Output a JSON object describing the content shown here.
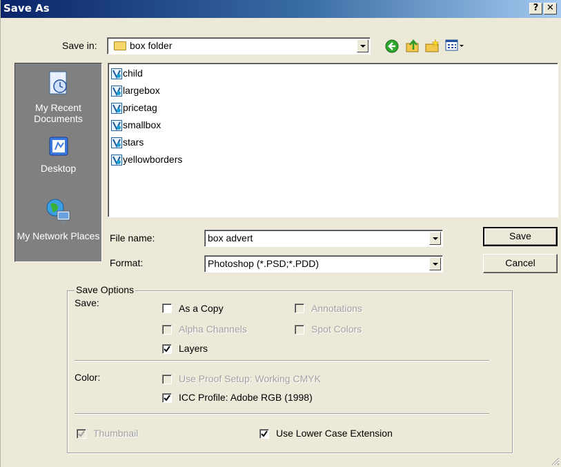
{
  "window": {
    "title": "Save As",
    "help_label": "?",
    "close_label": "✕"
  },
  "save_in": {
    "label": "Save in:",
    "value": "box folder"
  },
  "toolbar_icons": [
    "back-icon",
    "up-folder-icon",
    "new-folder-icon",
    "views-menu-icon"
  ],
  "places": [
    {
      "label": "My Recent Documents"
    },
    {
      "label": "Desktop"
    },
    {
      "label": "My Network Places"
    }
  ],
  "files": [
    "child",
    "largebox",
    "pricetag",
    "smallbox",
    "stars",
    "yellowborders"
  ],
  "file_name": {
    "label": "File name:",
    "value": "box advert"
  },
  "format": {
    "label": "Format:",
    "value": "Photoshop (*.PSD;*.PDD)"
  },
  "buttons": {
    "save": "Save",
    "cancel": "Cancel"
  },
  "save_options": {
    "legend": "Save Options",
    "save_label": "Save:",
    "as_a_copy": {
      "label": "As a Copy",
      "checked": false,
      "enabled": true
    },
    "annotations": {
      "label": "Annotations",
      "checked": false,
      "enabled": false
    },
    "alpha_channels": {
      "label": "Alpha Channels",
      "checked": false,
      "enabled": false
    },
    "spot_colors": {
      "label": "Spot Colors",
      "checked": false,
      "enabled": false
    },
    "layers": {
      "label": "Layers",
      "checked": true,
      "enabled": true
    },
    "color_label": "Color:",
    "use_proof_setup": {
      "label": "Use Proof Setup:  Working CMYK",
      "checked": false,
      "enabled": false
    },
    "icc_profile": {
      "label": "ICC Profile:  Adobe RGB (1998)",
      "checked": true,
      "enabled": true
    },
    "thumbnail": {
      "label": "Thumbnail",
      "checked": true,
      "enabled": false
    },
    "lower_case": {
      "label": "Use Lower Case Extension",
      "checked": true,
      "enabled": true
    }
  },
  "colors": {
    "title_start": "#0a246a",
    "title_end": "#a6caf0",
    "face": "#ece9d8",
    "places_bg": "#808080"
  }
}
